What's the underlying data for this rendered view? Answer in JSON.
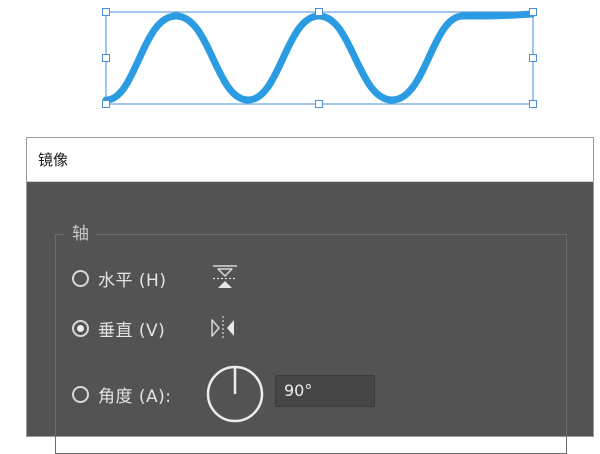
{
  "dialog": {
    "title": "镜像",
    "axis_group_label": "轴",
    "options": [
      {
        "label": "水平 (H)",
        "selected": false,
        "icon": "flip-horizontal-axis-icon"
      },
      {
        "label": "垂直 (V)",
        "selected": true,
        "icon": "flip-vertical-axis-icon"
      },
      {
        "label": "角度 (A):",
        "selected": false,
        "icon": "angle-dial-icon"
      }
    ],
    "angle_value": "90°"
  },
  "colors": {
    "wave": "#2b9ce2",
    "selection": "#4a8fd8",
    "dialog_bg": "#535353"
  }
}
